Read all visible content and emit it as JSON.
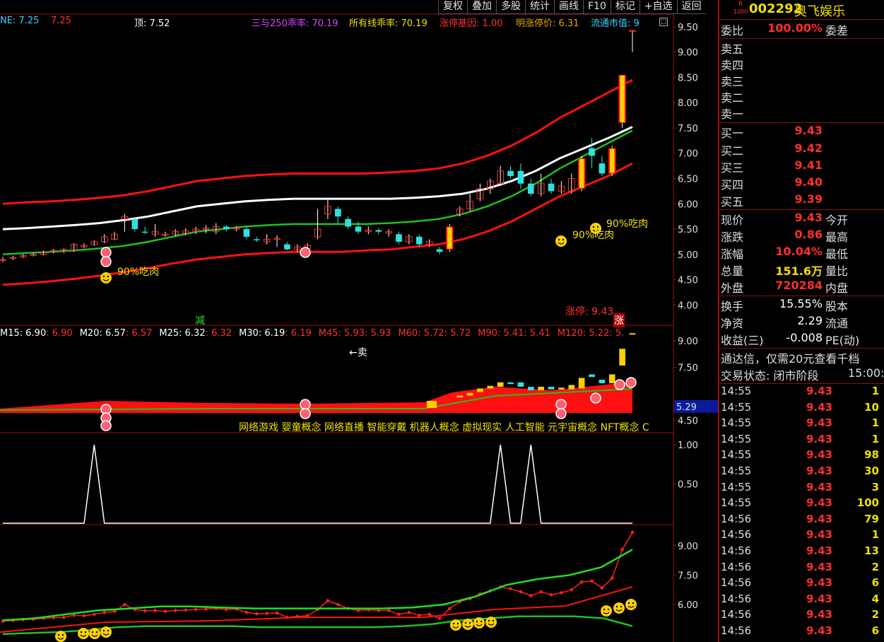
{
  "toolbar": {
    "buttons": [
      "复权",
      "叠加",
      "多股",
      "统计",
      "画线",
      "F10",
      "标记",
      "+自选",
      "返回"
    ]
  },
  "header": {
    "items": [
      {
        "text": "NE: 7.25",
        "color": "#3ad0ff"
      },
      {
        "text": "7.25",
        "color": "#ff3030"
      },
      {
        "text": "顶: 7.52",
        "color": "#ffffff"
      },
      {
        "text": "三与250乖率: 70.19",
        "color": "#e040ff"
      },
      {
        "text": "所有线乖率: 70.19",
        "color": "#f0e000"
      },
      {
        "text": "涨停基因: 1.00",
        "color": "#ff3030"
      },
      {
        "text": "明涨停价: 6.31",
        "color": "#f0a000"
      },
      {
        "text": "流通市值: 9",
        "color": "#3ad0ff"
      }
    ]
  },
  "annotations": {
    "eat_meat": "90%吃肉",
    "sell": "←卖",
    "limit_up": "涨停: 9.43",
    "reduce": "减",
    "rise": "涨"
  },
  "ma_line": [
    {
      "text": "M15: 6.90",
      "color": "#ffffff"
    },
    {
      "text": ": 6.90",
      "color": "#ff3030"
    },
    {
      "text": "M20: 6.57",
      "color": "#ffffff"
    },
    {
      "text": ": 6.57",
      "color": "#ff3030"
    },
    {
      "text": "M25: 6.32",
      "color": "#ffffff"
    },
    {
      "text": ": 6.32",
      "color": "#ff3030"
    },
    {
      "text": "M30: 6.19",
      "color": "#ffffff"
    },
    {
      "text": ": 6.19",
      "color": "#ff3030"
    },
    {
      "text": "M45: 5.93",
      "color": "#ff3030"
    },
    {
      "text": ": 5.93",
      "color": "#ff3030"
    },
    {
      "text": "M60: 5.72",
      "color": "#ff3030"
    },
    {
      "text": ": 5.72",
      "color": "#ff3030"
    },
    {
      "text": "M90: 5.41",
      "color": "#ff3030"
    },
    {
      "text": ": 5.41",
      "color": "#ff3030"
    },
    {
      "text": "M120: 5.22",
      "color": "#ff3030"
    },
    {
      "text": ": 5.",
      "color": "#ff3030"
    }
  ],
  "concepts": "网络游戏 婴童概念 网络直播 智能穿戴 机器人概念 虚拟现实 人工智能 元宇宙概念 NFT概念 C",
  "chart_data": [
    {
      "type": "candlestick",
      "panel": "main",
      "yticks": [
        9.5,
        9.0,
        8.5,
        8.0,
        7.5,
        7.0,
        6.5,
        6.0,
        5.5,
        5.0,
        4.5,
        4.0
      ],
      "ylim": [
        3.6,
        9.75
      ],
      "limit_up_price": 9.43,
      "candles": [
        [
          4.9,
          4.9,
          4.85,
          4.95
        ],
        [
          4.92,
          4.94,
          4.89,
          4.97
        ],
        [
          4.95,
          4.98,
          4.93,
          5.01
        ],
        [
          4.98,
          5.0,
          4.96,
          5.03
        ],
        [
          5.0,
          5.05,
          4.98,
          5.08
        ],
        [
          5.05,
          5.08,
          5.02,
          5.11
        ],
        [
          5.06,
          5.1,
          5.03,
          5.12
        ],
        [
          5.08,
          5.2,
          5.05,
          5.22
        ],
        [
          5.15,
          5.18,
          5.12,
          5.22
        ],
        [
          5.2,
          5.25,
          5.17,
          5.28
        ],
        [
          5.25,
          5.35,
          5.22,
          5.4
        ],
        [
          5.3,
          5.4,
          5.28,
          5.45
        ],
        [
          5.7,
          5.75,
          5.45,
          5.8
        ],
        [
          5.7,
          5.5,
          5.45,
          5.72
        ],
        [
          5.45,
          5.43,
          5.4,
          5.55
        ],
        [
          5.4,
          5.45,
          5.35,
          5.6
        ],
        [
          5.38,
          5.4,
          5.35,
          5.45
        ],
        [
          5.4,
          5.45,
          5.36,
          5.5
        ],
        [
          5.42,
          5.47,
          5.38,
          5.52
        ],
        [
          5.45,
          5.5,
          5.4,
          5.55
        ],
        [
          5.5,
          5.52,
          5.42,
          5.58
        ],
        [
          5.45,
          5.55,
          5.4,
          5.62
        ],
        [
          5.55,
          5.5,
          5.45,
          5.58
        ],
        [
          5.5,
          5.52,
          5.46,
          5.56
        ],
        [
          5.5,
          5.35,
          5.3,
          5.55
        ],
        [
          5.3,
          5.28,
          5.25,
          5.35
        ],
        [
          5.25,
          5.3,
          5.2,
          5.4
        ],
        [
          5.3,
          5.32,
          5.15,
          5.38
        ],
        [
          5.2,
          5.1,
          5.08,
          5.25
        ],
        [
          5.1,
          5.15,
          5.05,
          5.2
        ],
        [
          5.12,
          5.18,
          5.1,
          5.22
        ],
        [
          5.35,
          5.5,
          5.3,
          5.9
        ],
        [
          5.8,
          5.95,
          5.7,
          6.1
        ],
        [
          5.9,
          5.75,
          5.6,
          5.95
        ],
        [
          5.7,
          5.55,
          5.5,
          5.75
        ],
        [
          5.55,
          5.45,
          5.4,
          5.65
        ],
        [
          5.45,
          5.48,
          5.4,
          5.55
        ],
        [
          5.48,
          5.45,
          5.4,
          5.52
        ],
        [
          5.42,
          5.45,
          5.35,
          5.5
        ],
        [
          5.4,
          5.25,
          5.2,
          5.45
        ],
        [
          5.25,
          5.35,
          5.2,
          5.4
        ],
        [
          5.35,
          5.2,
          5.15,
          5.4
        ],
        [
          5.2,
          5.25,
          5.15,
          5.3
        ],
        [
          5.1,
          5.05,
          5.0,
          5.15
        ],
        [
          5.1,
          5.55,
          5.05,
          5.6
        ],
        [
          5.8,
          5.9,
          5.75,
          5.95
        ],
        [
          5.9,
          6.05,
          5.85,
          6.2
        ],
        [
          6.1,
          6.3,
          6.05,
          6.4
        ],
        [
          6.3,
          6.45,
          6.2,
          6.5
        ],
        [
          6.4,
          6.65,
          6.35,
          6.75
        ],
        [
          6.65,
          6.55,
          6.5,
          6.75
        ],
        [
          6.65,
          6.4,
          6.3,
          6.8
        ],
        [
          6.4,
          6.2,
          6.15,
          6.5
        ],
        [
          6.2,
          6.4,
          6.15,
          6.6
        ],
        [
          6.4,
          6.25,
          6.2,
          6.5
        ],
        [
          6.25,
          6.35,
          6.2,
          6.45
        ],
        [
          6.25,
          6.5,
          6.2,
          6.6
        ],
        [
          6.3,
          6.9,
          6.25,
          6.95
        ],
        [
          7.1,
          6.95,
          6.7,
          7.3
        ],
        [
          6.8,
          6.6,
          6.55,
          6.95
        ],
        [
          6.6,
          7.1,
          6.55,
          7.15
        ],
        [
          7.6,
          8.55,
          7.5,
          8.55
        ],
        [
          9.43,
          9.43,
          9.0,
          9.43
        ]
      ],
      "bands": {
        "white": [
          5.5,
          5.52,
          5.55,
          5.58,
          5.62,
          5.68,
          5.75,
          5.85,
          5.95,
          6.0,
          6.05,
          6.08,
          6.1,
          6.1,
          6.1,
          6.1,
          6.1,
          6.12,
          6.15,
          6.2,
          6.3,
          6.45,
          6.65,
          6.9,
          7.1,
          7.3,
          7.52
        ],
        "upper_red": [
          6.0,
          6.03,
          6.05,
          6.08,
          6.12,
          6.17,
          6.25,
          6.35,
          6.45,
          6.5,
          6.55,
          6.58,
          6.6,
          6.6,
          6.6,
          6.6,
          6.62,
          6.65,
          6.7,
          6.8,
          6.95,
          7.15,
          7.4,
          7.7,
          7.95,
          8.2,
          8.45
        ],
        "mid_green": [
          5.0,
          5.03,
          5.05,
          5.08,
          5.12,
          5.17,
          5.25,
          5.35,
          5.45,
          5.5,
          5.55,
          5.58,
          5.6,
          5.6,
          5.6,
          5.6,
          5.62,
          5.65,
          5.7,
          5.8,
          5.95,
          6.15,
          6.4,
          6.7,
          6.95,
          7.2,
          7.45
        ],
        "lower_red": [
          4.4,
          4.43,
          4.47,
          4.52,
          4.58,
          4.65,
          4.73,
          4.82,
          4.9,
          4.95,
          5.0,
          5.03,
          5.05,
          5.05,
          5.05,
          5.08,
          5.1,
          5.15,
          5.2,
          5.3,
          5.45,
          5.65,
          5.9,
          6.15,
          6.35,
          6.55,
          6.8
        ]
      }
    },
    {
      "type": "area",
      "panel": "volume_ma",
      "yticks": [
        9.0,
        7.5,
        5.29,
        4.5
      ],
      "highlight_value": 5.29,
      "ylim": [
        3.8,
        9.8
      ]
    },
    {
      "type": "line",
      "panel": "signal",
      "yticks": [
        1.0,
        0.5
      ],
      "ylim": [
        0,
        1.1
      ],
      "peaks": [
        9,
        49,
        52
      ]
    },
    {
      "type": "line",
      "panel": "bottom",
      "yticks": [
        9.0,
        7.5,
        6.0
      ],
      "ylim": [
        4.2,
        10.0
      ]
    }
  ],
  "sidebar": {
    "code": "002292",
    "name": "奥飞娱乐",
    "badge_top": "R",
    "badge_bottom": "1000",
    "weibi_label": "委比",
    "weibi_value": "100.00%",
    "weicha_label": "委差",
    "sell": [
      {
        "label": "卖五",
        "price": ""
      },
      {
        "label": "卖四",
        "price": ""
      },
      {
        "label": "卖三",
        "price": ""
      },
      {
        "label": "卖二",
        "price": ""
      },
      {
        "label": "卖一",
        "price": ""
      }
    ],
    "buy": [
      {
        "label": "买一",
        "price": "9.43"
      },
      {
        "label": "买二",
        "price": "9.42"
      },
      {
        "label": "买三",
        "price": "9.41"
      },
      {
        "label": "买四",
        "price": "9.40"
      },
      {
        "label": "买五",
        "price": "9.39"
      }
    ],
    "stats": [
      {
        "label": "现价",
        "value": "9.43",
        "color": "#ff3030",
        "label2": "今开"
      },
      {
        "label": "涨跌",
        "value": "0.86",
        "color": "#ff3030",
        "label2": "最高"
      },
      {
        "label": "涨幅",
        "value": "10.04%",
        "color": "#ff3030",
        "label2": "最低"
      },
      {
        "label": "总量",
        "value": "151.6万",
        "color": "#f0e000",
        "label2": "量比"
      },
      {
        "label": "外盘",
        "value": "720284",
        "color": "#ff3030",
        "label2": "内盘"
      }
    ],
    "stats2": [
      {
        "label": "换手",
        "value": "15.55%",
        "color": "#ffffff",
        "label2": "股本"
      },
      {
        "label": "净资",
        "value": "2.29",
        "color": "#ffffff",
        "label2": "流通"
      },
      {
        "label": "收益(三)",
        "value": "-0.008",
        "color": "#ffffff",
        "label2": "PE(动)"
      }
    ],
    "notice": "通达信，仅需20元查看千档",
    "status_label": "交易状态: 闭市阶段",
    "status_time": "15:00:0",
    "ticks": [
      {
        "time": "14:55",
        "price": "9.43",
        "vol": "1"
      },
      {
        "time": "14:55",
        "price": "9.43",
        "vol": "10"
      },
      {
        "time": "14:55",
        "price": "9.43",
        "vol": "1"
      },
      {
        "time": "14:55",
        "price": "9.43",
        "vol": "1"
      },
      {
        "time": "14:55",
        "price": "9.43",
        "vol": "98"
      },
      {
        "time": "14:55",
        "price": "9.43",
        "vol": "30"
      },
      {
        "time": "14:55",
        "price": "9.43",
        "vol": "3"
      },
      {
        "time": "14:55",
        "price": "9.43",
        "vol": "100"
      },
      {
        "time": "14:56",
        "price": "9.43",
        "vol": "79"
      },
      {
        "time": "14:56",
        "price": "9.43",
        "vol": "1"
      },
      {
        "time": "14:56",
        "price": "9.43",
        "vol": "13"
      },
      {
        "time": "14:56",
        "price": "9.43",
        "vol": "2"
      },
      {
        "time": "14:56",
        "price": "9.43",
        "vol": "6"
      },
      {
        "time": "14:56",
        "price": "9.43",
        "vol": "4"
      },
      {
        "time": "14:56",
        "price": "9.43",
        "vol": "2"
      },
      {
        "time": "14:56",
        "price": "9.43",
        "vol": "6"
      }
    ]
  }
}
